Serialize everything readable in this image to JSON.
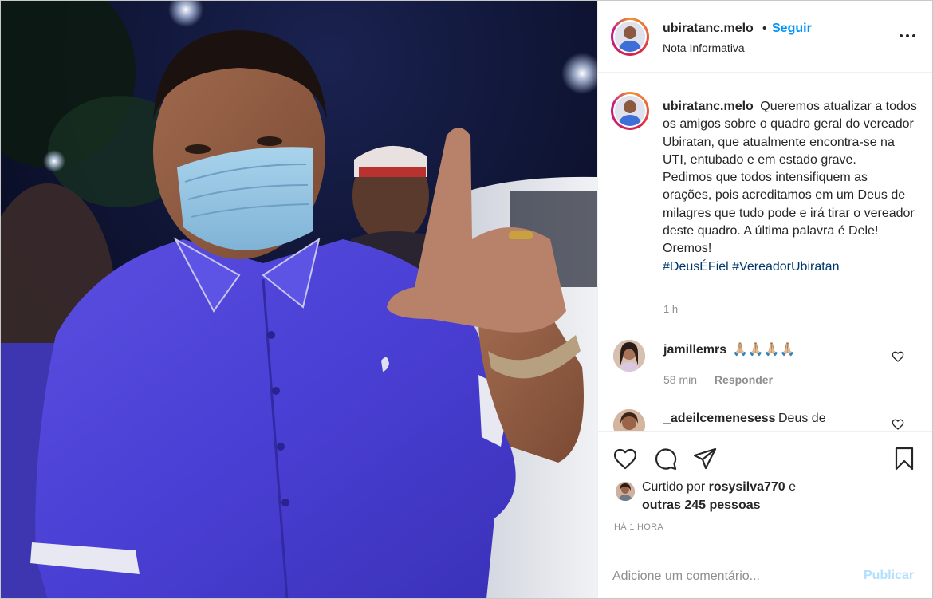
{
  "post": {
    "username": "ubiratanc.melo",
    "follow_label": "Seguir",
    "dot": "•",
    "subtitle": "Nota Informativa"
  },
  "caption": {
    "username": "ubiratanc.melo",
    "text": "Queremos atualizar a todos os amigos sobre o quadro geral do vereador Ubiratan, que atualmente encontra-se na UTI, entubado e em estado grave.",
    "text2": "Pedimos que todos intensifiquem as orações, pois acreditamos em um Deus de milagres que tudo pode e irá tirar o vereador deste quadro. A última palavra é Dele! Oremos!",
    "hashtags": [
      "#DeusÉFiel",
      "#VereadorUbiratan"
    ],
    "time": "1 h"
  },
  "comments": [
    {
      "username": "jamillemrs",
      "text": "🙏🏼🙏🏼🙏🏼🙏🏼",
      "time": "58 min",
      "reply_label": "Responder"
    },
    {
      "username": "_adeilcemenesess",
      "text": "Deus de"
    }
  ],
  "likes": {
    "prefix": "Curtido por",
    "user": "rosysilva770",
    "connector": "e",
    "others": "outras 245 pessoas"
  },
  "post_date": "HÁ 1 HORA",
  "comment_input": {
    "placeholder": "Adicione um comentário..."
  },
  "publish_label": "Publicar",
  "icons": [
    "more-icon",
    "heart-icon",
    "comment-icon",
    "share-icon",
    "bookmark-icon"
  ],
  "colors": {
    "follow": "#0095f6",
    "hashtag": "#00376b",
    "publish_disabled": "#b2dffc",
    "secondary_text": "#8e8e8e"
  }
}
